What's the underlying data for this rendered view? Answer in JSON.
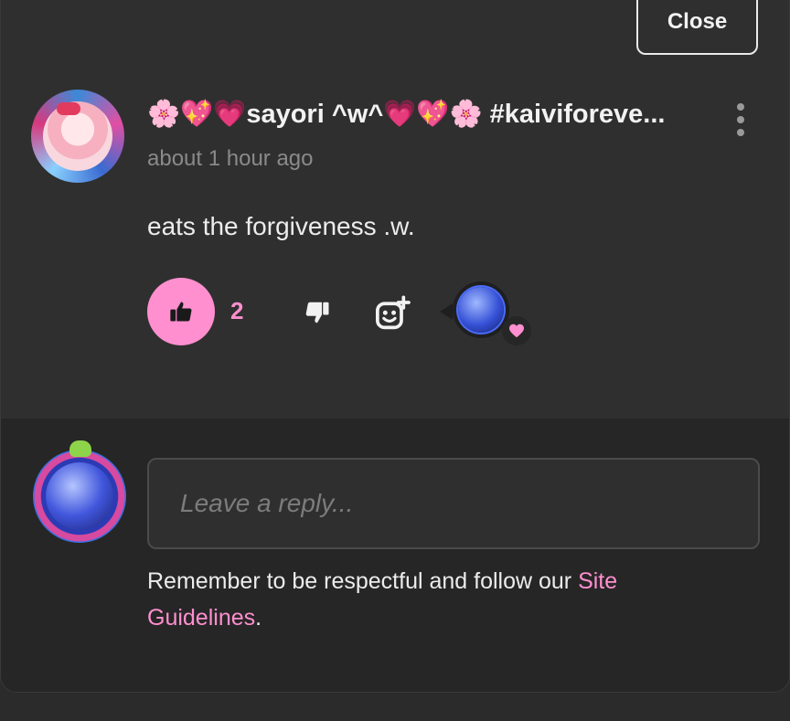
{
  "dialog": {
    "close_label": "Close"
  },
  "comment": {
    "author": "🌸💖💗sayori ^w^💗💖🌸 #kaiviforeve...",
    "timestamp": "about 1 hour ago",
    "text": "eats the forgiveness .w.",
    "like_count": "2",
    "reaction_emoji": "heart"
  },
  "reply": {
    "placeholder": "Leave a reply...",
    "notice_prefix": "Remember to be respectful and follow our ",
    "notice_link": "Site Guidelines",
    "notice_suffix": "."
  },
  "colors": {
    "accent": "#ff8fcf",
    "background": "#2f2f2f",
    "reply_background": "#262626",
    "muted_text": "#8a8a8a"
  },
  "icons": {
    "like": "thumbs-up-icon",
    "dislike": "thumbs-down-icon",
    "react": "add-reaction-icon",
    "menu": "kebab-menu-icon",
    "reaction": "heart-icon"
  }
}
